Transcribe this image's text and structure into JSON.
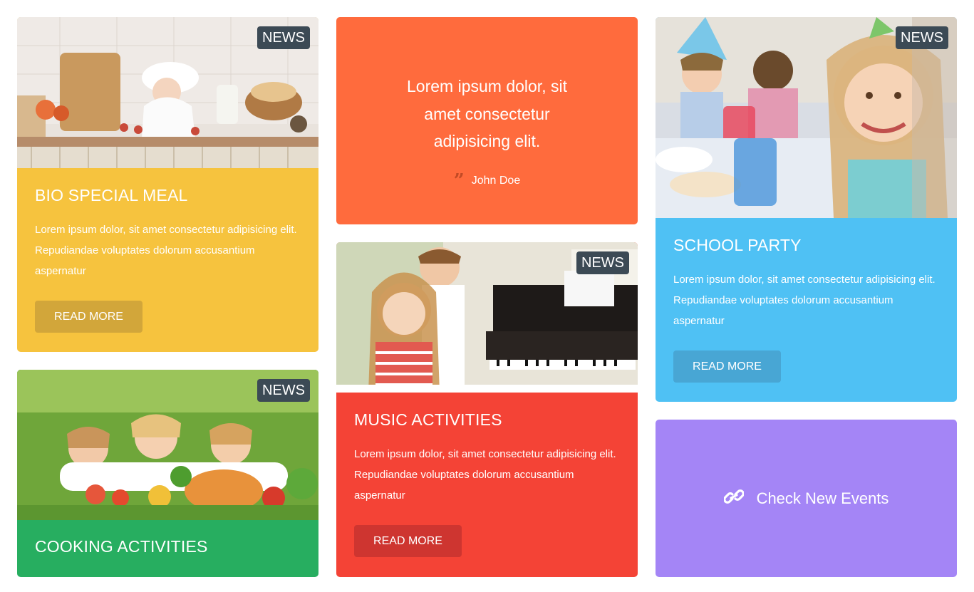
{
  "badge_text": "NEWS",
  "cards": {
    "bio": {
      "title": "BIO SPECIAL MEAL",
      "text": "Lorem ipsum dolor, sit amet consectetur adipisicing elit. Repudiandae voluptates dolorum accusantium aspernatur",
      "button": "READ MORE",
      "color": "#f6c33e"
    },
    "cooking": {
      "title": "COOKING ACTIVITIES",
      "color": "#27ae60"
    },
    "quote": {
      "text": "Lorem ipsum dolor, sit amet consectetur adipisicing elit.",
      "author": "John Doe",
      "color": "#ff6b3d",
      "icon": "quote-icon"
    },
    "music": {
      "title": "MUSIC ACTIVITIES",
      "text": "Lorem ipsum dolor, sit amet consectetur adipisicing elit. Repudiandae voluptates dolorum accusantium aspernatur",
      "button": "READ MORE",
      "color": "#f44336"
    },
    "party": {
      "title": "SCHOOL PARTY",
      "text": "Lorem ipsum dolor, sit amet consectetur adipisicing elit. Repudiandae voluptates dolorum accusantium aspernatur",
      "button": "READ MORE",
      "color": "#4fc1f4"
    },
    "events": {
      "label": "Check New Events",
      "icon": "link-icon",
      "color": "#a485f6"
    }
  }
}
